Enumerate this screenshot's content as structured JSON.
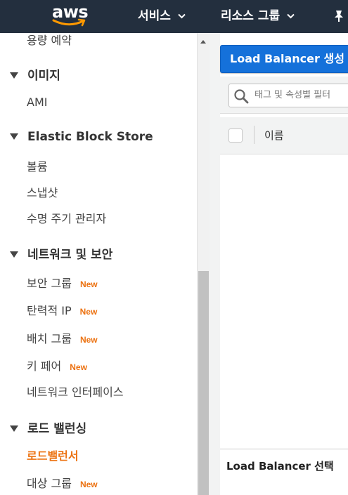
{
  "header": {
    "logo": "aws",
    "nav": [
      {
        "label": "서비스"
      },
      {
        "label": "리소스 그룹"
      }
    ]
  },
  "sidebar": {
    "partial_top": "용량 예약",
    "sections": [
      {
        "title": "이미지",
        "items": [
          {
            "label": "AMI"
          }
        ]
      },
      {
        "title": "Elastic Block Store",
        "items": [
          {
            "label": "볼륨"
          },
          {
            "label": "스냅샷"
          },
          {
            "label": "수명 주기 관리자"
          }
        ]
      },
      {
        "title": "네트워크 및 보안",
        "items": [
          {
            "label": "보안 그룹",
            "badge": "New"
          },
          {
            "label": "탄력적 IP",
            "badge": "New"
          },
          {
            "label": "배치 그룹",
            "badge": "New"
          },
          {
            "label": "키 페어",
            "badge": "New"
          },
          {
            "label": "네트워크 인터페이스"
          }
        ]
      },
      {
        "title": "로드 밸런싱",
        "items": [
          {
            "label": "로드밸런서",
            "active": true
          },
          {
            "label": "대상 그룹",
            "badge": "New"
          }
        ]
      }
    ]
  },
  "main": {
    "create_button": "Load Balancer 생성",
    "search_placeholder": "태그 및 속성별 필터",
    "table": {
      "columns": [
        "이름"
      ]
    },
    "bottom_panel_title": "Load Balancer 선택"
  },
  "colors": {
    "navbar": "#232f3e",
    "accent_orange": "#ec7211",
    "primary_button": "#1571da",
    "panel_bg": "#f2f3f3"
  }
}
